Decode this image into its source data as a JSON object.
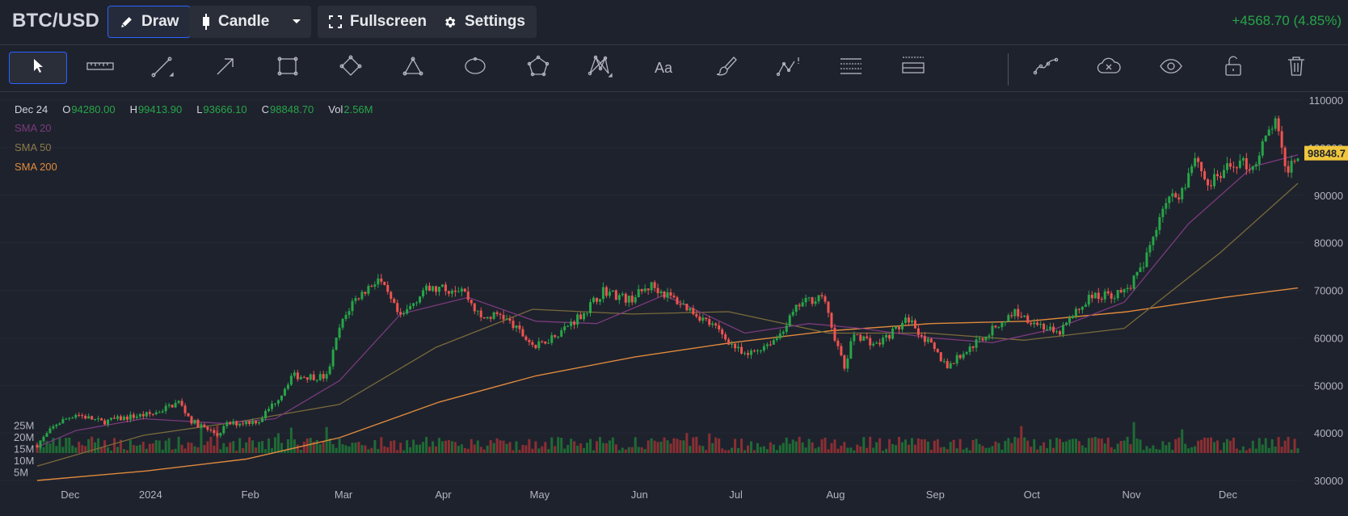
{
  "header": {
    "symbol": "BTC/USD",
    "draw_label": "Draw",
    "chart_type_label": "Candle",
    "fullscreen_label": "Fullscreen",
    "settings_label": "Settings",
    "change_text": "+4568.70 (4.85%)"
  },
  "colors": {
    "up": "#26a647",
    "down": "#ef5350",
    "sma20": "#7b3a7d",
    "sma50": "#7a6a3a",
    "sma200": "#e08a3c",
    "price_label_bg": "#f0c63c",
    "accent": "#2962ff"
  },
  "toolbar": {
    "tools": [
      {
        "name": "cursor-icon",
        "active": true
      },
      {
        "name": "ruler-icon"
      },
      {
        "name": "trend-line-icon"
      },
      {
        "name": "arrow-icon"
      },
      {
        "name": "rectangle-icon"
      },
      {
        "name": "rotated-rectangle-icon"
      },
      {
        "name": "triangle-icon"
      },
      {
        "name": "ellipse-icon"
      },
      {
        "name": "polygon-icon"
      },
      {
        "name": "xabcd-pattern-icon"
      },
      {
        "name": "text-icon"
      },
      {
        "name": "brush-icon"
      },
      {
        "name": "price-note-icon"
      },
      {
        "name": "fib-retracement-icon"
      },
      {
        "name": "price-range-icon"
      },
      {
        "name": "path-icon"
      },
      {
        "name": "remove-drawings-icon"
      },
      {
        "name": "visibility-icon"
      },
      {
        "name": "lock-icon"
      },
      {
        "name": "trash-icon"
      }
    ]
  },
  "legend": {
    "date": "Dec 24",
    "open_key": "O",
    "open": "94280.00",
    "high_key": "H",
    "high": "99413.90",
    "low_key": "L",
    "low": "93666.10",
    "close_key": "C",
    "close": "98848.70",
    "vol_key": "Vol",
    "vol": "2.56M",
    "sma20_label": "SMA 20",
    "sma50_label": "SMA 50",
    "sma200_label": "SMA 200",
    "text_value": "Aa"
  },
  "chart_data": {
    "type": "candlestick",
    "title": "BTC/USD",
    "y_ticks": [
      "110000",
      "100000",
      "90000",
      "80000",
      "70000",
      "60000",
      "50000",
      "40000",
      "30000"
    ],
    "ylim": [
      30000,
      110000
    ],
    "x_ticks": [
      "Dec",
      "2024",
      "Feb",
      "Mar",
      "Apr",
      "May",
      "Jun",
      "Jul",
      "Aug",
      "Sep",
      "Oct",
      "Nov",
      "Dec"
    ],
    "volume_ticks": [
      "25M",
      "20M",
      "15M",
      "10M",
      "5M"
    ],
    "volume_lim": [
      0,
      30
    ],
    "last_price_label": "98848.7",
    "close_path": [
      [
        "2023-11-28",
        37500
      ],
      [
        "2023-12-04",
        41900
      ],
      [
        "2023-12-10",
        44000
      ],
      [
        "2023-12-18",
        42300
      ],
      [
        "2023-12-27",
        43400
      ],
      [
        "2024-01-03",
        44000
      ],
      [
        "2024-01-11",
        46500
      ],
      [
        "2024-01-15",
        42500
      ],
      [
        "2024-01-23",
        39600
      ],
      [
        "2024-01-26",
        41800
      ],
      [
        "2024-02-05",
        42600
      ],
      [
        "2024-02-12",
        48300
      ],
      [
        "2024-02-15",
        52000
      ],
      [
        "2024-02-26",
        51800
      ],
      [
        "2024-03-01",
        62000
      ],
      [
        "2024-03-05",
        67500
      ],
      [
        "2024-03-13",
        72500
      ],
      [
        "2024-03-20",
        64000
      ],
      [
        "2024-03-27",
        70000
      ],
      [
        "2024-04-08",
        70500
      ],
      [
        "2024-04-14",
        64000
      ],
      [
        "2024-04-20",
        65000
      ],
      [
        "2024-05-01",
        58000
      ],
      [
        "2024-05-10",
        62000
      ],
      [
        "2024-05-17",
        66000
      ],
      [
        "2024-05-22",
        70000
      ],
      [
        "2024-05-30",
        68000
      ],
      [
        "2024-06-06",
        71000
      ],
      [
        "2024-06-18",
        66000
      ],
      [
        "2024-06-26",
        62000
      ],
      [
        "2024-07-05",
        56000
      ],
      [
        "2024-07-15",
        60000
      ],
      [
        "2024-07-22",
        67000
      ],
      [
        "2024-07-29",
        69000
      ],
      [
        "2024-08-05",
        53500
      ],
      [
        "2024-08-08",
        61000
      ],
      [
        "2024-08-15",
        58500
      ],
      [
        "2024-08-25",
        64000
      ],
      [
        "2024-09-06",
        54000
      ],
      [
        "2024-09-15",
        59000
      ],
      [
        "2024-09-27",
        65500
      ],
      [
        "2024-10-07",
        62000
      ],
      [
        "2024-10-10",
        60500
      ],
      [
        "2024-10-20",
        68500
      ],
      [
        "2024-10-31",
        69500
      ],
      [
        "2024-11-06",
        75000
      ],
      [
        "2024-11-12",
        88000
      ],
      [
        "2024-11-18",
        91000
      ],
      [
        "2024-11-22",
        98500
      ],
      [
        "2024-11-26",
        92000
      ],
      [
        "2024-12-05",
        97000
      ],
      [
        "2024-12-10",
        96000
      ],
      [
        "2024-12-17",
        106000
      ],
      [
        "2024-12-20",
        95000
      ],
      [
        "2024-12-24",
        98848.7
      ]
    ],
    "sma20_path": [
      [
        "2023-11-28",
        37000
      ],
      [
        "2023-12-10",
        40500
      ],
      [
        "2023-12-31",
        43000
      ],
      [
        "2024-01-25",
        42000
      ],
      [
        "2024-02-10",
        43000
      ],
      [
        "2024-03-01",
        51000
      ],
      [
        "2024-03-20",
        65000
      ],
      [
        "2024-04-10",
        68500
      ],
      [
        "2024-05-01",
        63500
      ],
      [
        "2024-05-20",
        63000
      ],
      [
        "2024-06-10",
        69000
      ],
      [
        "2024-07-05",
        61000
      ],
      [
        "2024-07-25",
        63000
      ],
      [
        "2024-08-10",
        62000
      ],
      [
        "2024-09-01",
        60000
      ],
      [
        "2024-09-20",
        59000
      ],
      [
        "2024-10-10",
        62000
      ],
      [
        "2024-10-31",
        67500
      ],
      [
        "2024-11-20",
        84000
      ],
      [
        "2024-12-10",
        96000
      ],
      [
        "2024-12-24",
        98500
      ]
    ],
    "sma50_path": [
      [
        "2023-11-28",
        33000
      ],
      [
        "2023-12-31",
        39500
      ],
      [
        "2024-01-31",
        42500
      ],
      [
        "2024-03-01",
        46000
      ],
      [
        "2024-03-31",
        58000
      ],
      [
        "2024-04-30",
        66000
      ],
      [
        "2024-05-31",
        65000
      ],
      [
        "2024-06-30",
        65500
      ],
      [
        "2024-07-31",
        61000
      ],
      [
        "2024-08-31",
        61000
      ],
      [
        "2024-09-30",
        59500
      ],
      [
        "2024-10-31",
        62000
      ],
      [
        "2024-11-30",
        78000
      ],
      [
        "2024-12-24",
        92500
      ]
    ],
    "sma200_path": [
      [
        "2023-11-28",
        30000
      ],
      [
        "2024-01-01",
        32000
      ],
      [
        "2024-02-01",
        34500
      ],
      [
        "2024-03-01",
        39000
      ],
      [
        "2024-04-01",
        46500
      ],
      [
        "2024-05-01",
        52000
      ],
      [
        "2024-06-01",
        56000
      ],
      [
        "2024-07-01",
        59000
      ],
      [
        "2024-08-01",
        61500
      ],
      [
        "2024-09-01",
        63000
      ],
      [
        "2024-10-01",
        63500
      ],
      [
        "2024-11-01",
        65500
      ],
      [
        "2024-12-01",
        68500
      ],
      [
        "2024-12-24",
        70500
      ]
    ]
  }
}
